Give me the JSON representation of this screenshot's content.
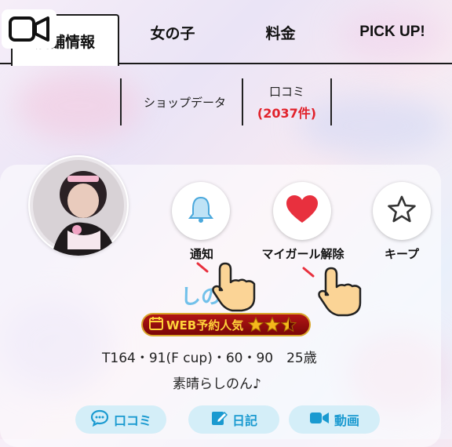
{
  "tabs": [
    {
      "label": "店舗情報"
    },
    {
      "label": "女の子"
    },
    {
      "label": "料金"
    },
    {
      "label": "PICK UP!"
    }
  ],
  "subtabs": {
    "shop_data": "ショップデータ",
    "reviews_label": "口コミ",
    "reviews_count": "(2037件)"
  },
  "actions": {
    "notify": "通知",
    "mygirl": "マイガール解除",
    "keep": "キープ"
  },
  "profile": {
    "name": "しの",
    "badge": "WEB予約人気",
    "rating": 2.5,
    "stats": "T164・91(F cup)・60・90　25歳",
    "catchphrase": "素晴らしのん♪"
  },
  "bottom_buttons": {
    "reviews": "口コミ",
    "diary": "日記",
    "video": "動画"
  },
  "colors": {
    "accent_red": "#e1222b",
    "heart_red": "#e8303e",
    "bell_blue": "#4aa8dc",
    "pill_bg": "#d4eef8",
    "pill_text": "#1a9ad0",
    "badge_gold": "#ffd23a"
  }
}
